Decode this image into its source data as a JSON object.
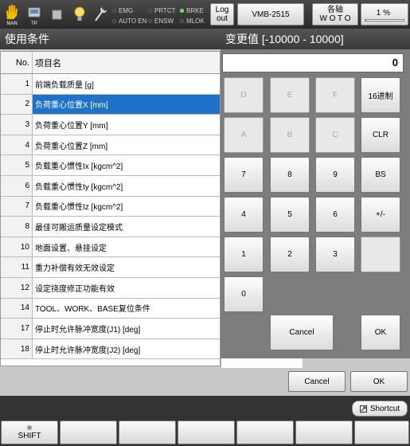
{
  "topbar": {
    "man_label": "MAN",
    "tp_label": "TP",
    "indicators": [
      {
        "label": "EMG",
        "on": false
      },
      {
        "label": "AUTO EN",
        "on": false
      },
      {
        "label": "PRTCT",
        "on": false
      },
      {
        "label": "ENSW",
        "on": false
      },
      {
        "label": "BRKE",
        "on": true
      },
      {
        "label": "MLOK",
        "on": false
      }
    ],
    "logout_label": "Log out",
    "robot_name": "VMB-2515",
    "axis_label_line1": "各轴",
    "axis_label_line2": "W O T O",
    "percent_label": "1 %",
    "percent_value": 0.03
  },
  "left_panel": {
    "title": "使用条件",
    "header_no": "No.",
    "header_name": "项目名",
    "rows": [
      {
        "no": "1",
        "name": "前端负载质量 [g]"
      },
      {
        "no": "2",
        "name": "负荷重心位置X [mm]"
      },
      {
        "no": "3",
        "name": "负荷重心位置Y [mm]"
      },
      {
        "no": "4",
        "name": "负荷重心位置Z [mm]"
      },
      {
        "no": "5",
        "name": "负载重心惯性Ix [kgcm^2]"
      },
      {
        "no": "6",
        "name": "负载重心惯性Iy [kgcm^2]"
      },
      {
        "no": "7",
        "name": "负载重心惯性Iz [kgcm^2]"
      },
      {
        "no": "8",
        "name": "最佳可搬运质量设定模式"
      },
      {
        "no": "10",
        "name": "地面设置、悬挂设定"
      },
      {
        "no": "11",
        "name": "重力补偿有效无效设定"
      },
      {
        "no": "12",
        "name": "设定挠度修正功能有效"
      },
      {
        "no": "14",
        "name": "TOOL、WORK、BASE复位条件"
      },
      {
        "no": "17",
        "name": "停止时允许脉冲宽度(J1) [deg]"
      },
      {
        "no": "18",
        "name": "停止时允许脉冲宽度(J2) [deg]"
      }
    ],
    "selected_index": 1
  },
  "keypad": {
    "title": "变更值 [-10000 - 10000]",
    "value": "0",
    "keys": {
      "d": "D",
      "e": "E",
      "f": "F",
      "hex": "16进制",
      "a": "A",
      "b": "B",
      "c": "C",
      "clr": "CLR",
      "k7": "7",
      "k8": "8",
      "k9": "9",
      "bs": "BS",
      "k4": "4",
      "k5": "5",
      "k6": "6",
      "sign": "+/-",
      "k1": "1",
      "k2": "2",
      "k3": "3",
      "dot": ".",
      "k0": "0",
      "cancel": "Cancel",
      "ok": "OK"
    }
  },
  "dialog": {
    "cancel_label": "Cancel",
    "ok_label": "OK"
  },
  "bottom": {
    "shortcut_label": "Shortcut",
    "shift_label": "SHIFT"
  }
}
